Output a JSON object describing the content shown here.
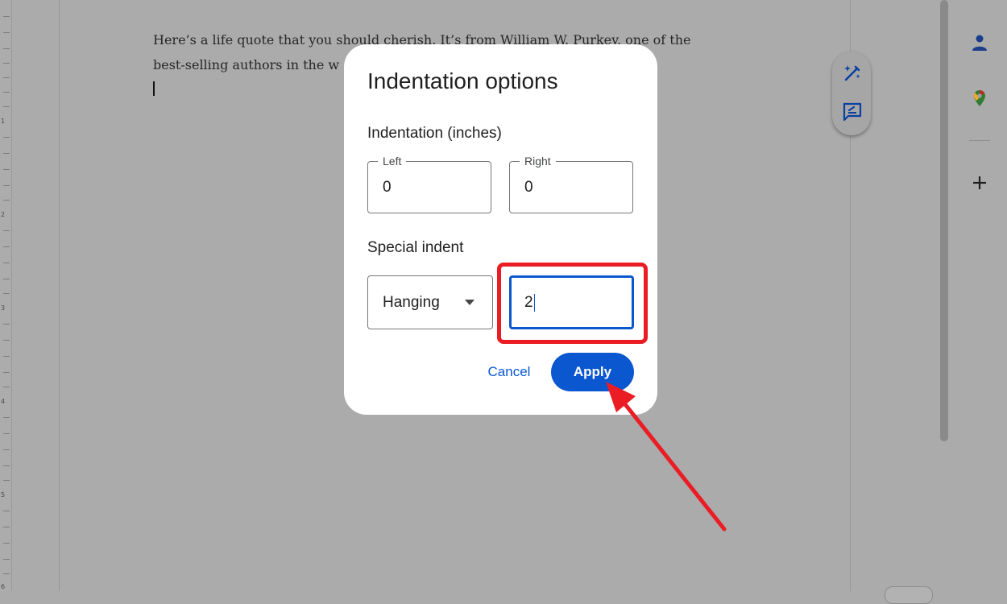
{
  "document": {
    "line1": "Here’s a life quote that you should cherish. It’s from William W. Purkey, one of the",
    "line2": "best-selling authors in the w"
  },
  "ruler": {
    "numbers": [
      "1",
      "2",
      "3",
      "4",
      "5",
      "6"
    ]
  },
  "dialog": {
    "title": "Indentation options",
    "indentation_label": "Indentation (inches)",
    "left": {
      "label": "Left",
      "value": "0"
    },
    "right": {
      "label": "Right",
      "value": "0"
    },
    "special_label": "Special indent",
    "special_type": "Hanging",
    "special_value": "2",
    "cancel_label": "Cancel",
    "apply_label": "Apply"
  },
  "colors": {
    "accent": "#0b57d0",
    "annotation": "#ea1c24",
    "overlay": "#ababab"
  },
  "icons": {
    "float_tools": [
      "magic-pen-icon",
      "feedback-chat-icon"
    ],
    "side_panel": [
      "contacts-icon",
      "maps-icon",
      "add-icon"
    ]
  }
}
